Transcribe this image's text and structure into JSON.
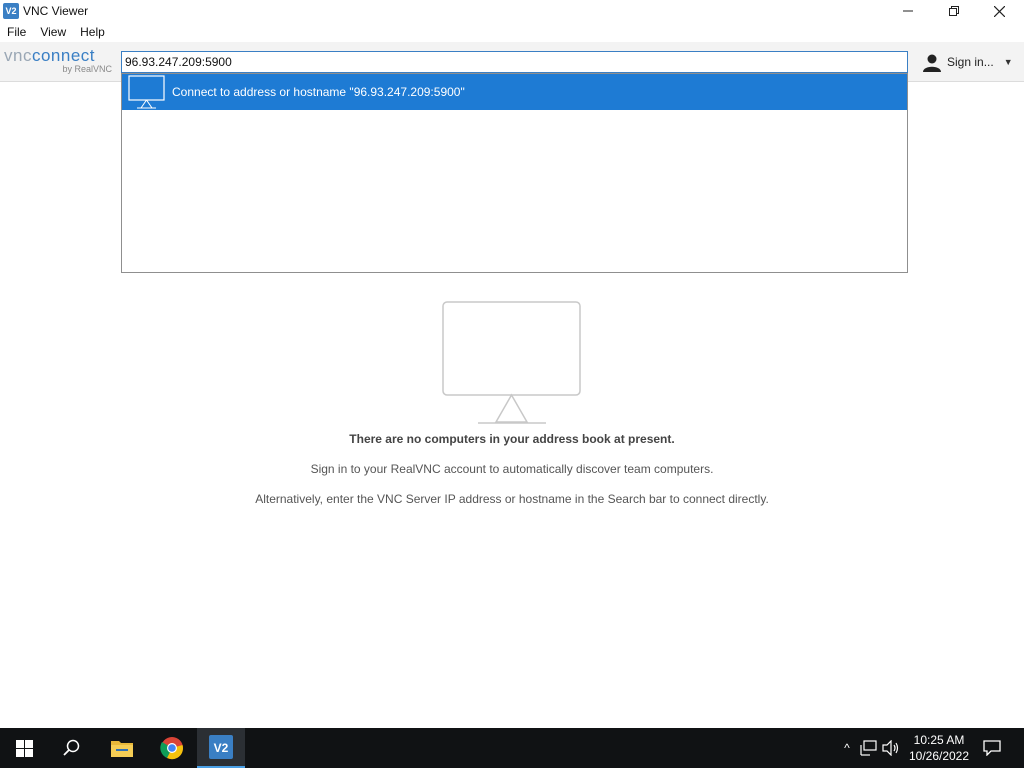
{
  "window": {
    "title": "VNC Viewer",
    "app_icon_label": "V2"
  },
  "menu": [
    "File",
    "View",
    "Help"
  ],
  "toolbar": {
    "logo": {
      "vnc": "vnc",
      "connect": "connect",
      "sub": "by RealVNC"
    },
    "search_value": "96.93.247.209:5900",
    "signin_label": "Sign in...",
    "accent_color": "#3a7fc4"
  },
  "dropdown": {
    "suggestion": "Connect to address or hostname \"96.93.247.209:5900\"",
    "highlight_color": "#1e7bd4"
  },
  "empty_state": {
    "title": "There are no computers in your address book at present.",
    "line1": "Sign in to your RealVNC account to automatically discover team computers.",
    "line2": "Alternatively, enter the VNC Server IP address or hostname in the Search bar to connect directly."
  },
  "taskbar": {
    "items": [
      "windows-start-icon",
      "search-icon",
      "file-explorer-icon",
      "chrome-icon",
      "vnc-viewer-icon"
    ],
    "clock": {
      "time": "10:25 AM",
      "date": "10/26/2022"
    }
  }
}
